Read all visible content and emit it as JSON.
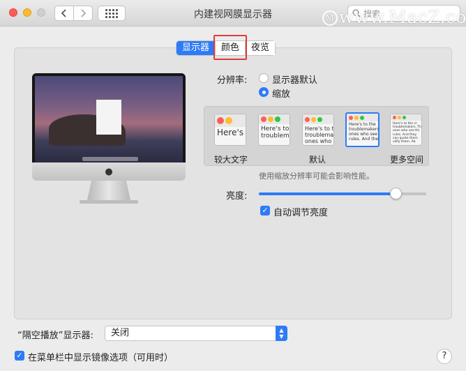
{
  "window": {
    "title": "内建视网膜显示器"
  },
  "toolbar": {
    "search_placeholder": "搜索"
  },
  "watermark": {
    "text": "www.MacZ.com",
    "icon_letter": "M"
  },
  "tabs": [
    "显示器",
    "颜色",
    "夜览"
  ],
  "resolution": {
    "label": "分辨率:",
    "options": [
      "显示器默认",
      "缩放"
    ],
    "selected": "缩放"
  },
  "scale": {
    "left_label": "较大文字",
    "middle_label": "默认",
    "right_label": "更多空间",
    "selected_index": 3,
    "thumbnails": [
      {
        "text": "Here's"
      },
      {
        "text": "Here's to\ntroublem"
      },
      {
        "text": "Here's to t\ntroublema\nones who"
      },
      {
        "text": "Here's to the\ntroublemakers.\nones who see t\nrules. And the"
      },
      {
        "text": "Here's to the cr\ntroublemakers. Th\nones who see thi\nrules. And they\ncan quote them\nvilify them. Ab"
      }
    ],
    "note": "使用缩放分辨率可能会影响性能。"
  },
  "brightness": {
    "label": "亮度:",
    "level": 0.82,
    "auto_label": "自动调节亮度",
    "auto_checked": true
  },
  "airplay": {
    "label": "“隔空播放”显示器:",
    "value": "关闭"
  },
  "mirroring": {
    "label": "在菜单栏中显示镜像选项（可用时）",
    "checked": true
  },
  "help": {
    "label": "?"
  },
  "colors": {
    "accent": "#2e7bf6",
    "highlight_box": "#e03b3b"
  }
}
